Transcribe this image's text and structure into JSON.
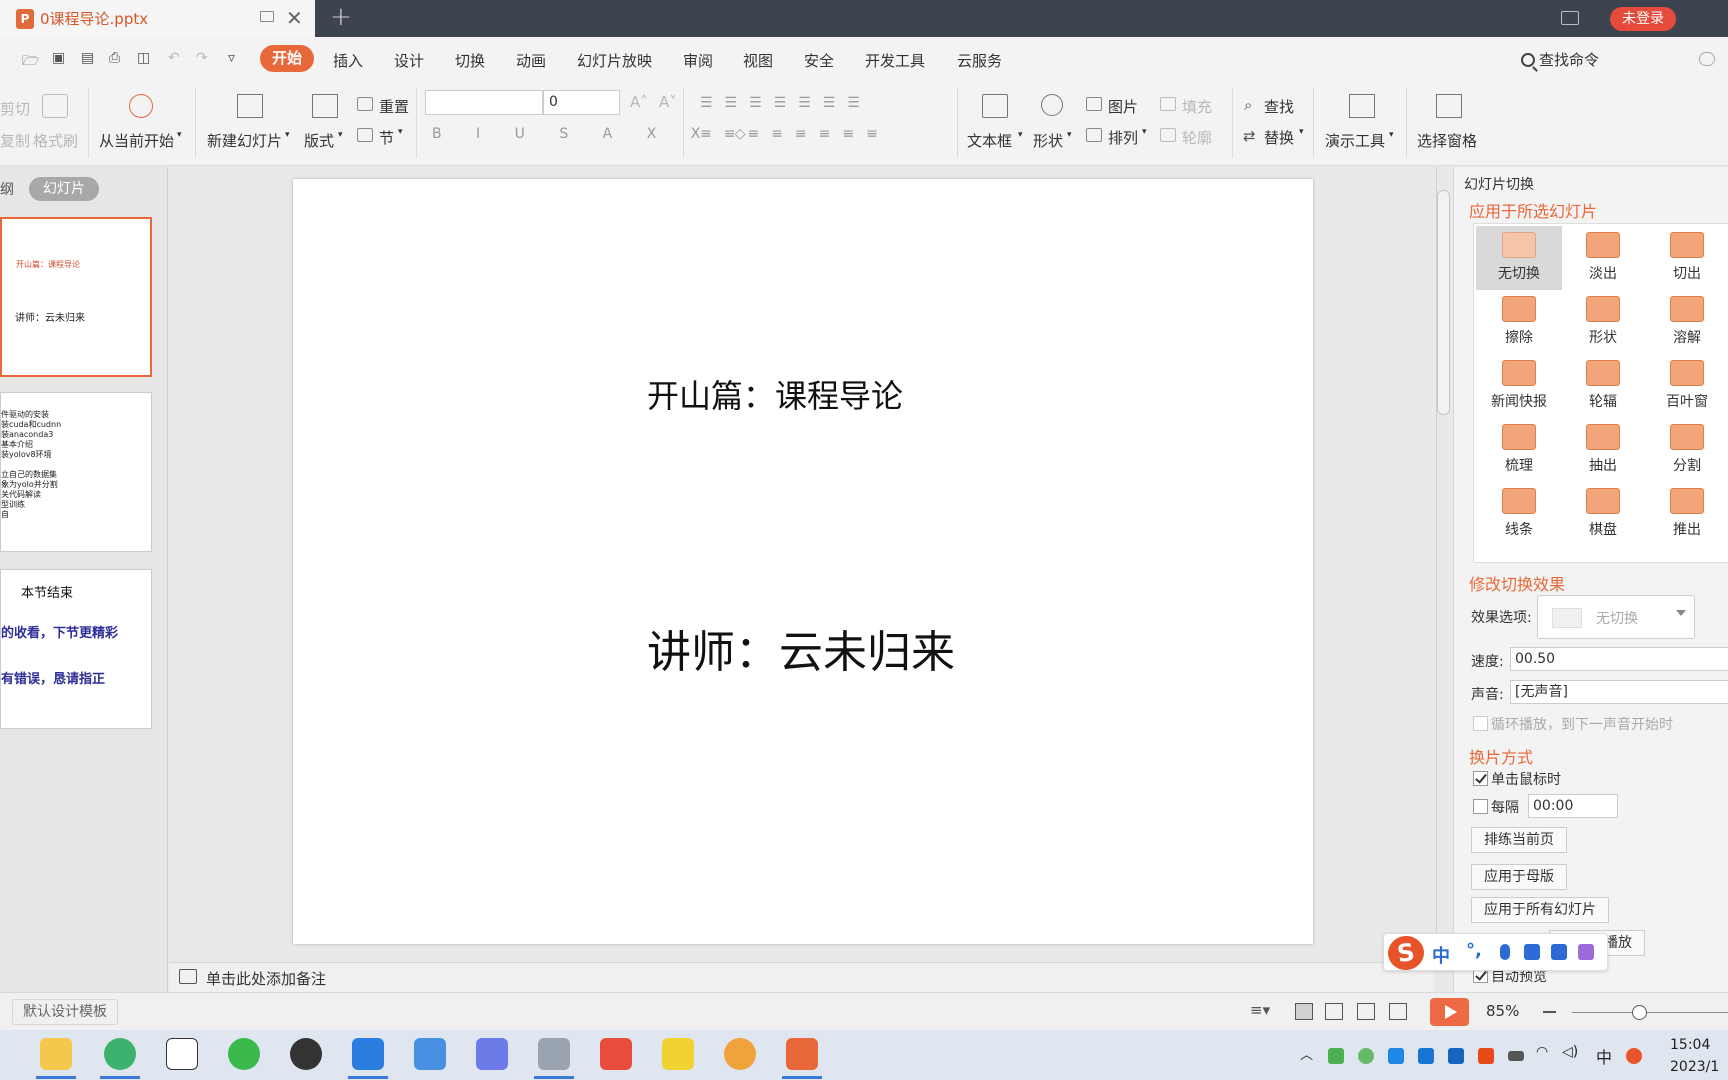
{
  "titlebar": {
    "tab_title": "0课程导论.pptx",
    "tab_icon": "P",
    "login_label": "未登录"
  },
  "menubar": {
    "active_tab": "开始",
    "tabs": [
      "插入",
      "设计",
      "切换",
      "动画",
      "幻灯片放映",
      "审阅",
      "视图",
      "安全",
      "开发工具",
      "云服务"
    ],
    "find_command": "查找命令"
  },
  "ribbon": {
    "clip_cut": "剪切",
    "clip_copy": "复制",
    "format_painter": "格式刷",
    "start_from_current": "从当前开始",
    "new_slide": "新建幻灯片",
    "layout": "版式",
    "reset": "重置",
    "section": "节",
    "font_size": "0",
    "text_box": "文本框",
    "shape": "形状",
    "picture": "图片",
    "fill": "填充",
    "arrange": "排列",
    "outline": "轮廓",
    "find": "查找",
    "replace": "替换",
    "presentation_tools": "演示工具",
    "selection_pane": "选择窗格"
  },
  "leftpane": {
    "outline_tab": "纲",
    "slides_tab": "幻灯片",
    "thumb1": {
      "title": "开山篇：课程导论",
      "sub": "讲师：云未归来"
    },
    "thumb2_lines": [
      "件驱动的安装",
      "装cuda和cudnn",
      "装anaconda3",
      "基本介绍",
      "装yolov8环境",
      "",
      "立自己的数据集",
      "象为yolo并分割",
      "关代码解读",
      "型训练",
      "自"
    ],
    "thumb3": {
      "head": "本节结束",
      "line1": "的收看，下节更精彩",
      "line2": "有错误，恳请指正"
    }
  },
  "slide": {
    "title": "开山篇：课程导论",
    "subtitle": "讲师：云未归来"
  },
  "notes": {
    "placeholder": "单击此处添加备注"
  },
  "rightpane": {
    "header": "幻灯片切换",
    "apply_selected": "应用于所选幻灯片",
    "transitions": [
      "无切换",
      "淡出",
      "切出",
      "擦除",
      "形状",
      "溶解",
      "新闻快报",
      "轮辐",
      "百叶窗",
      "梳理",
      "抽出",
      "分割",
      "线条",
      "棋盘",
      "推出"
    ],
    "modify_effect": "修改切换效果",
    "effect_options_label": "效果选项:",
    "effect_options_value": "无切换",
    "speed_label": "速度:",
    "speed_value": "00.50",
    "sound_label": "声音:",
    "sound_value": "[无声音]",
    "loop_sound": "循环播放，到下一声音开始时",
    "advance_title": "换片方式",
    "on_click": "单击鼠标时",
    "every_label": "每隔",
    "every_value": "00:00",
    "rehearse": "排练当前页",
    "apply_master": "应用于母版",
    "apply_all": "应用于所有幻灯片",
    "slideshow": "幻灯片播放",
    "auto_preview": "自动预览"
  },
  "ime": {
    "logo": "S",
    "mode": "中",
    "punct": "°,"
  },
  "statusbar": {
    "template": "默认设计模板",
    "zoom": "85%",
    "zoom_level": 0.85
  },
  "taskbar": {
    "tray_lang": "中",
    "time": "15:04",
    "date": "2023/1"
  },
  "colors": {
    "accent": "#e8683a",
    "titlebar_bg": "#3e4350",
    "login_red": "#e64a3b",
    "taskbar_bg": "#dfe6ef"
  }
}
